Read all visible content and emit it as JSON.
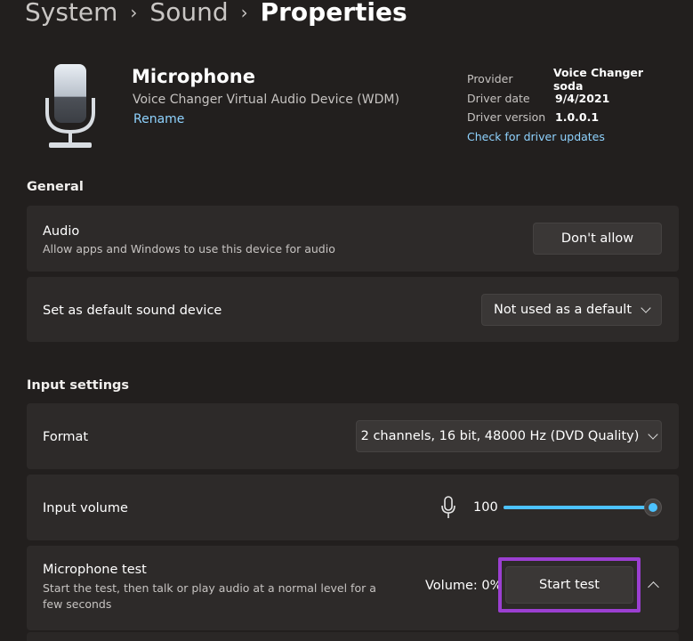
{
  "breadcrumb": {
    "items": [
      "System",
      "Sound",
      "Properties"
    ]
  },
  "device": {
    "name": "Microphone",
    "description": "Voice Changer Virtual Audio Device (WDM)",
    "rename_label": "Rename",
    "icon": "microphone-icon"
  },
  "driver": {
    "rows": [
      {
        "key": "Provider",
        "value": "Voice Changer soda"
      },
      {
        "key": "Driver date",
        "value": "9/4/2021"
      },
      {
        "key": "Driver version",
        "value": "1.0.0.1"
      }
    ],
    "update_link": "Check for driver updates"
  },
  "general": {
    "title": "General",
    "audio": {
      "title": "Audio",
      "subtitle": "Allow apps and Windows to use this device for audio",
      "button": "Don't allow"
    },
    "default_device": {
      "title": "Set as default sound device",
      "selected": "Not used as a default"
    }
  },
  "input": {
    "title": "Input settings",
    "format": {
      "title": "Format",
      "selected": "2 channels, 16 bit, 48000 Hz (DVD Quality)"
    },
    "volume": {
      "title": "Input volume",
      "value": "100",
      "level": 1.0
    },
    "mic_test": {
      "title": "Microphone test",
      "subtitle": "Start the test, then talk or play audio at a normal level for a few seconds",
      "volume_readout": "Volume: 0%",
      "button": "Start test"
    }
  },
  "colors": {
    "accent": "#4cc2ff",
    "link": "#8fd3ff",
    "highlight": "#9b3fd1",
    "background": "#221f1e",
    "card": "#2d2a29"
  }
}
